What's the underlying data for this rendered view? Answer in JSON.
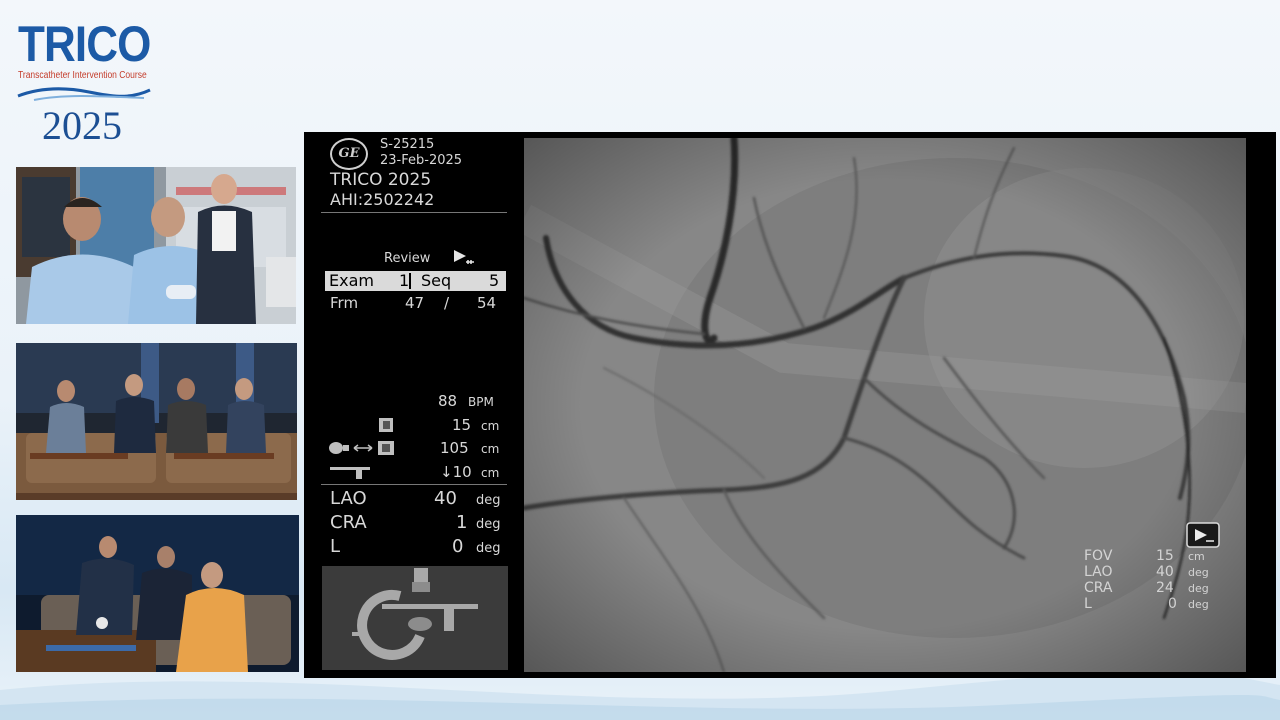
{
  "logo": {
    "brand": "TRICO",
    "tagline": "Transcatheter Intervention Course",
    "year": "2025"
  },
  "monitor": {
    "study_id": "S-25215",
    "date": "23-Feb-2025",
    "title": "TRICO 2025",
    "ahi": "AHI:2502242",
    "review_label": "Review",
    "exam_label": "Exam",
    "exam_value": "1",
    "seq_label": "Seq",
    "seq_value": "5",
    "frm_label": "Frm",
    "frm_current": "47",
    "frm_sep": "/",
    "frm_total": "54",
    "bpm_value": "88",
    "bpm_unit": "BPM",
    "fov_value": "15",
    "fov_unit": "cm",
    "sid_value": "105",
    "sid_unit": "cm",
    "table_value": "↓10",
    "table_unit": "cm",
    "angles": [
      {
        "label": "LAO",
        "value": "40",
        "unit": "deg"
      },
      {
        "label": "CRA",
        "value": "1",
        "unit": "deg"
      },
      {
        "label": "L",
        "value": "0",
        "unit": "deg"
      }
    ],
    "overlay": [
      {
        "label": "FOV",
        "value": "15",
        "unit": "cm"
      },
      {
        "label": "LAO",
        "value": "40",
        "unit": "deg"
      },
      {
        "label": "CRA",
        "value": "24",
        "unit": "deg"
      },
      {
        "label": "L",
        "value": "0",
        "unit": "deg"
      }
    ]
  }
}
